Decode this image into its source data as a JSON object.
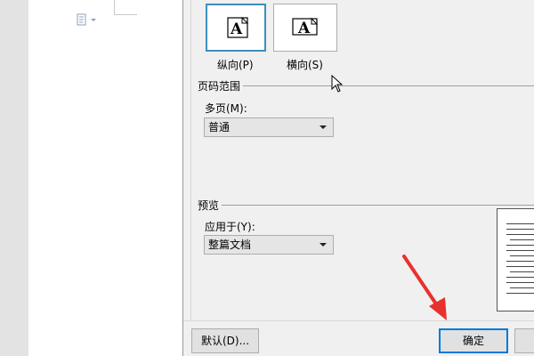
{
  "orientation": {
    "portrait_glyph": "A",
    "portrait_label": "纵向(P)",
    "landscape_glyph": "A",
    "landscape_label": "横向(S)",
    "selected": "portrait"
  },
  "page_range": {
    "title": "页码范围",
    "multi_label": "多页(M):",
    "multi_value": "普通"
  },
  "preview": {
    "title": "预览",
    "apply_label": "应用于(Y):",
    "apply_value": "整篇文档"
  },
  "buttons": {
    "default_label": "默认(D)...",
    "ok_label": "确定"
  },
  "colors": {
    "selected_border": "#3c8fbf",
    "default_button_border": "#0078d7",
    "annotation_arrow": "#e8312f"
  },
  "icons": [
    "paste-icon",
    "mouse-cursor-icon",
    "red-arrow-annotation"
  ]
}
